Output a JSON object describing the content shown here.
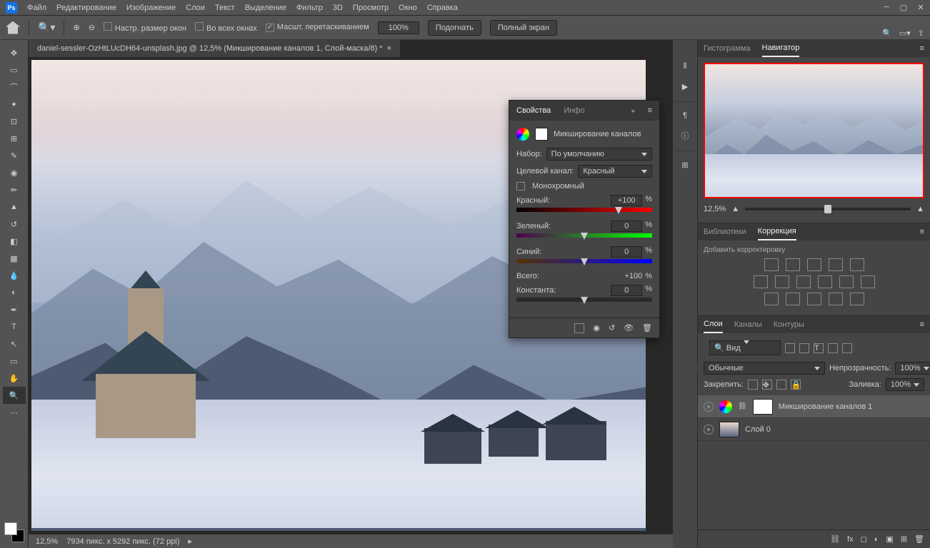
{
  "menu": {
    "items": [
      "Файл",
      "Редактирование",
      "Изображение",
      "Слои",
      "Текст",
      "Выделение",
      "Фильтр",
      "3D",
      "Просмотр",
      "Окно",
      "Справка"
    ]
  },
  "options": {
    "resize_windows": "Настр. размер окон",
    "all_windows": "Во всех окнах",
    "scrubby": "Маcшт. перетаскиванием",
    "zoom_value": "100%",
    "fit": "Подогнать",
    "fullscreen": "Полный экран"
  },
  "doc": {
    "title": "daniel-sessler-OzHtLUcDH64-unsplash.jpg @ 12,5% (Микширование каналов 1, Слой-маска/8) *"
  },
  "status": {
    "zoom": "12,5%",
    "dims": "7934 пикс. x 5292 пикс. (72 ppi)"
  },
  "nav": {
    "histogram": "Гистограмма",
    "navigator": "Навигатор",
    "zoom": "12,5%"
  },
  "libs": {
    "libraries": "Библиотеки",
    "correction": "Коррекция",
    "add": "Добавить корректировку"
  },
  "layers": {
    "tab_layers": "Слои",
    "tab_channels": "Каналы",
    "tab_paths": "Контуры",
    "kind": "Вид",
    "blend": "Обычные",
    "opacity_label": "Непрозрачность:",
    "opacity": "100%",
    "lock": "Закрепить:",
    "fill_label": "Заливка:",
    "fill": "100%",
    "layer1": "Микширование каналов 1",
    "layer2": "Слой 0"
  },
  "props": {
    "tab_props": "Свойства",
    "tab_info": "Инфо",
    "title": "Микширование каналов",
    "preset_label": "Набор:",
    "preset": "По умолчанию",
    "channel_label": "Целевой канал:",
    "channel": "Красный",
    "mono": "Монохромный",
    "red_label": "Красный:",
    "red_val": "+100",
    "green_label": "Зеленый:",
    "green_val": "0",
    "blue_label": "Синий:",
    "blue_val": "0",
    "total_label": "Всего:",
    "total_val": "+100",
    "const_label": "Константа:",
    "const_val": "0",
    "pct": "%"
  }
}
